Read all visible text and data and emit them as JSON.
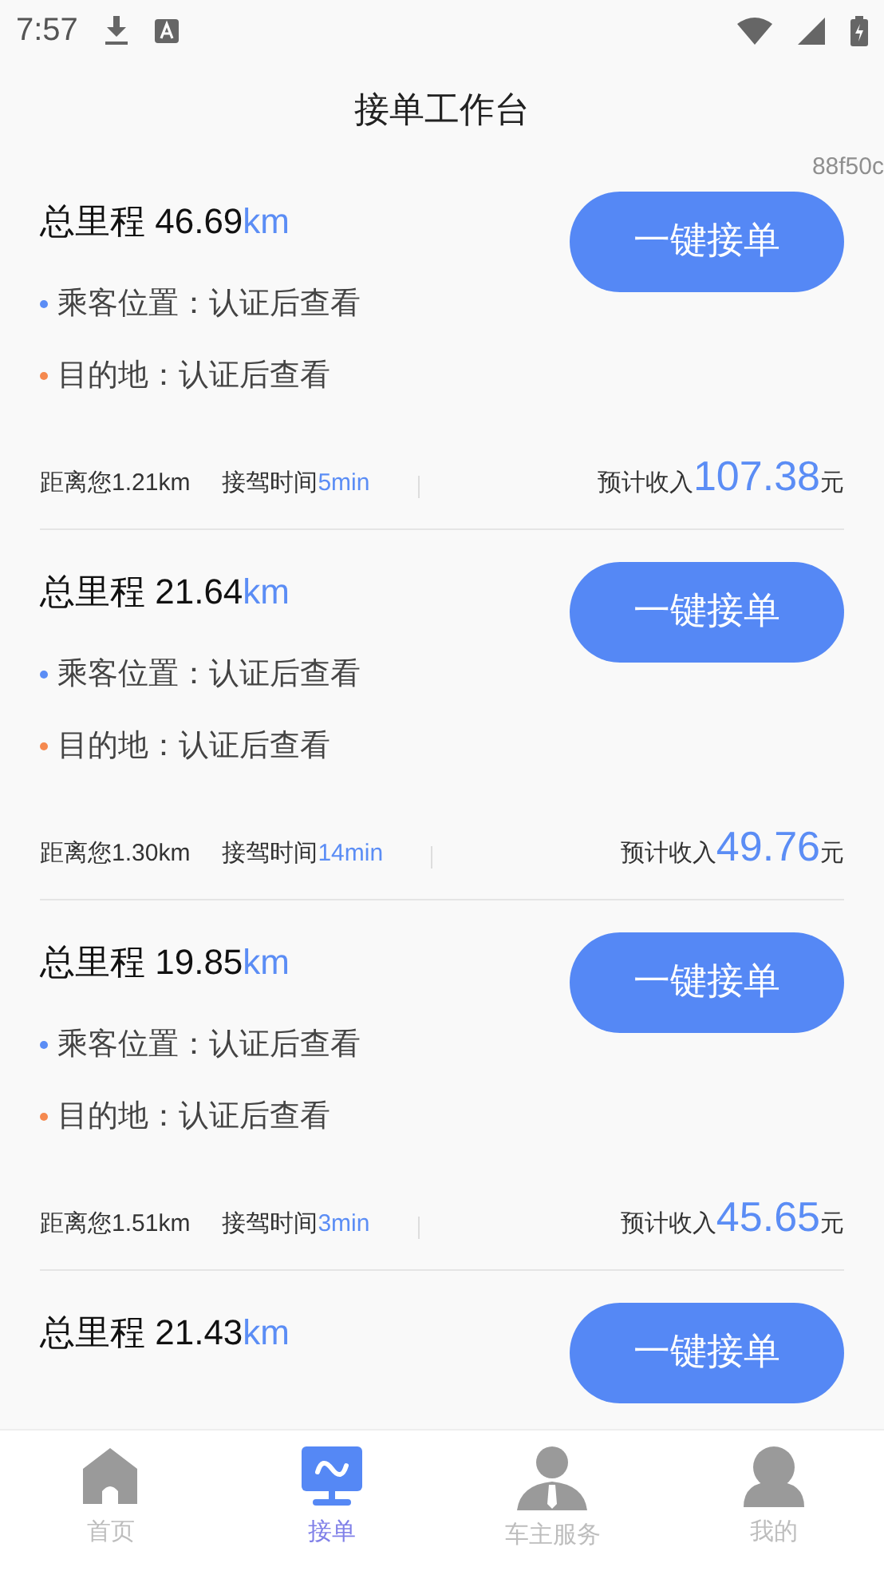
{
  "status_bar": {
    "time": "7:57"
  },
  "title": "接单工作台",
  "code_label": "88f50c",
  "orders": [
    {
      "mileage_label": "总里程",
      "mileage": "46.69",
      "unit": "km",
      "button": "一键接单",
      "points": [
        {
          "text": "乘客位置：认证后查看",
          "color": "#5b8df5"
        },
        {
          "text": "目的地：认证后查看",
          "color": "#f5894f"
        }
      ],
      "distance_away": "距离您1.21km",
      "pickup_time_label": "接驾时间",
      "pickup_time": "5min",
      "income_label": "预计收入",
      "income": "107.38",
      "currency": "元"
    },
    {
      "mileage_label": "总里程",
      "mileage": "21.64",
      "unit": "km",
      "button": "一键接单",
      "points": [
        {
          "text": "乘客位置：认证后查看",
          "color": "#5b8df5"
        },
        {
          "text": "目的地：认证后查看",
          "color": "#f5894f"
        }
      ],
      "distance_away": "距离您1.30km",
      "pickup_time_label": "接驾时间",
      "pickup_time": "14min",
      "income_label": "预计收入",
      "income": "49.76",
      "currency": "元"
    },
    {
      "mileage_label": "总里程",
      "mileage": "19.85",
      "unit": "km",
      "button": "一键接单",
      "points": [
        {
          "text": "乘客位置：认证后查看",
          "color": "#5b8df5"
        },
        {
          "text": "目的地：认证后查看",
          "color": "#f5894f"
        }
      ],
      "distance_away": "距离您1.51km",
      "pickup_time_label": "接驾时间",
      "pickup_time": "3min",
      "income_label": "预计收入",
      "income": "45.65",
      "currency": "元"
    },
    {
      "mileage_label": "总里程",
      "mileage": "21.43",
      "unit": "km",
      "button": "一键接单"
    }
  ],
  "tabs": [
    {
      "label": "首页",
      "selected": false
    },
    {
      "label": "接单",
      "selected": true
    },
    {
      "label": "车主服务",
      "selected": false
    },
    {
      "label": "我的",
      "selected": false
    }
  ]
}
